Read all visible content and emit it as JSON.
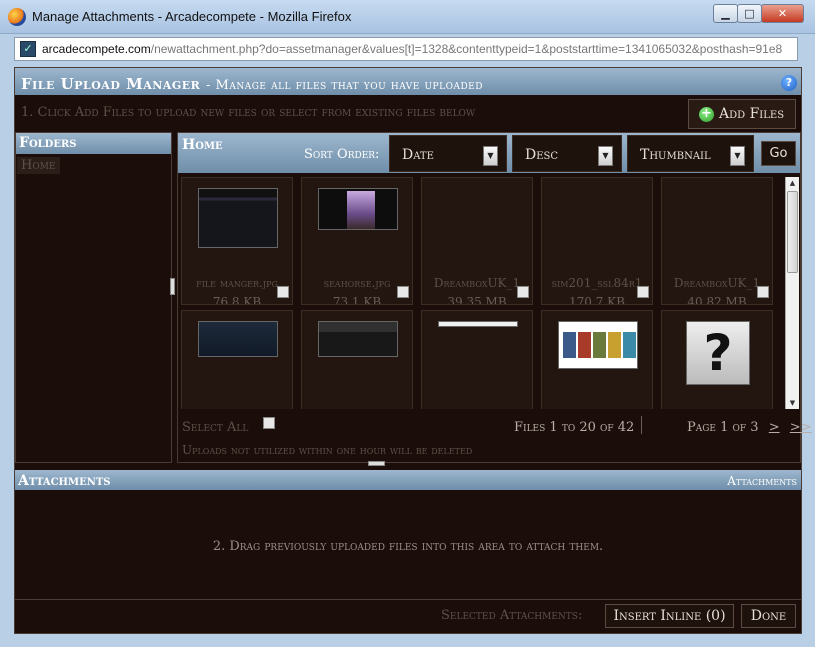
{
  "window": {
    "title": "Manage Attachments - Arcadecompete - Mozilla Firefox",
    "min_glyph": "▁",
    "max_glyph": "□",
    "close_glyph": "✕"
  },
  "urlbar": {
    "domain": "arcadecompete.com",
    "path": "/newattachment.php?do=assetmanager&values[t]=1328&contenttypeid=1&poststarttime=1341065032&posthash=91e8"
  },
  "manager": {
    "title": "File Upload Manager",
    "subtitle": "- Manage all files that you have uploaded",
    "help_glyph": "?",
    "instruction": "1. Click Add Files to upload new files or select from existing files below",
    "add_files_label": "Add Files"
  },
  "folders": {
    "title": "Folders",
    "items": [
      "Home"
    ]
  },
  "home": {
    "title": "Home",
    "sort_label": "Sort Order:",
    "sort_field": "Date",
    "sort_direction": "Desc",
    "view_mode": "Thumbnail",
    "go_label": "Go",
    "files": [
      {
        "name": "file manger.jpg",
        "size": "76.8 KB"
      },
      {
        "name": "seahorse.jpg",
        "size": "73.1 KB"
      },
      {
        "name": "DreamboxUK_1",
        "size": "39.35 MB"
      },
      {
        "name": "sim201_ssl84r1",
        "size": "170.7 KB"
      },
      {
        "name": "DreamboxUK_1",
        "size": "40.82 MB"
      },
      {
        "name": "",
        "size": ""
      },
      {
        "name": "",
        "size": ""
      },
      {
        "name": "",
        "size": ""
      },
      {
        "name": "",
        "size": ""
      },
      {
        "name": "",
        "size": ""
      }
    ],
    "select_all_label": "Select All",
    "files_count": "Files 1 to 20 of 42",
    "page_info": "Page 1 of 3",
    "next_label": ">",
    "last_label": ">>",
    "uploads_note": "Uploads not utilized within one hour will be deleted"
  },
  "attachments": {
    "title": "Attachments",
    "right_label": "Attachments",
    "drag_note": "2. Drag previously uploaded files into this area to attach them.",
    "selected_label": "Selected Attachments:",
    "insert_inline_label": "Insert Inline (0)",
    "done_label": "Done"
  },
  "icons": {
    "browser": "firefox-icon",
    "site": "site-favicon",
    "help": "help-icon",
    "add": "plus-icon",
    "dropdown": "chevron-down-icon"
  },
  "colors": {
    "header_blue": "#8aa7c2",
    "dialog_bg": "#1b0e0a",
    "muted_text": "#5e5049"
  }
}
